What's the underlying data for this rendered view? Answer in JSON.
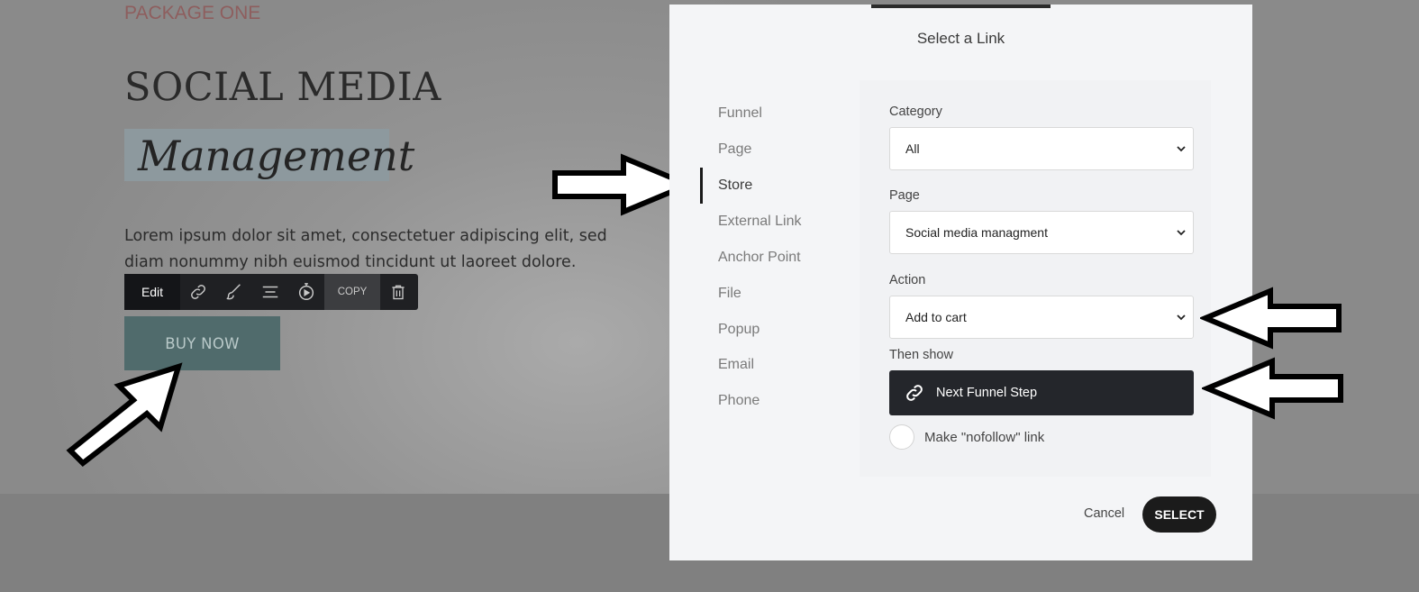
{
  "background_page": {
    "eyebrow": "PACKAGE ONE",
    "heading_line1": "SOCIAL MEDIA",
    "heading_line2": "Management",
    "body_text": "Lorem ipsum dolor sit amet, consectetuer adipiscing elit, sed diam nonummy nibh euismod tincidunt ut laoreet dolore.",
    "button_label": "BUY NOW"
  },
  "toolbar": {
    "edit_label": "Edit",
    "copy_label": "COPY",
    "icons": [
      "link-icon",
      "brush-icon",
      "align-icon",
      "timer-icon",
      "trash-icon"
    ]
  },
  "modal": {
    "title": "Select a Link",
    "nav_items": [
      "Funnel",
      "Page",
      "Store",
      "External Link",
      "Anchor Point",
      "File",
      "Popup",
      "Email",
      "Phone"
    ],
    "active_nav": "Store",
    "fields": {
      "category": {
        "label": "Category",
        "value": "All"
      },
      "page": {
        "label": "Page",
        "value": "Social media managment"
      },
      "action": {
        "label": "Action",
        "value": "Add to cart"
      }
    },
    "then_show_label": "Then show",
    "then_show_value": "Next Funnel Step",
    "nofollow_label": "Make \"nofollow\" link",
    "cancel_label": "Cancel",
    "select_label": "SELECT"
  },
  "colors": {
    "overlay": "#949494",
    "modal_bg": "#f4f5f7",
    "dark_button": "#24262b",
    "buy_button": "#506b6c"
  }
}
